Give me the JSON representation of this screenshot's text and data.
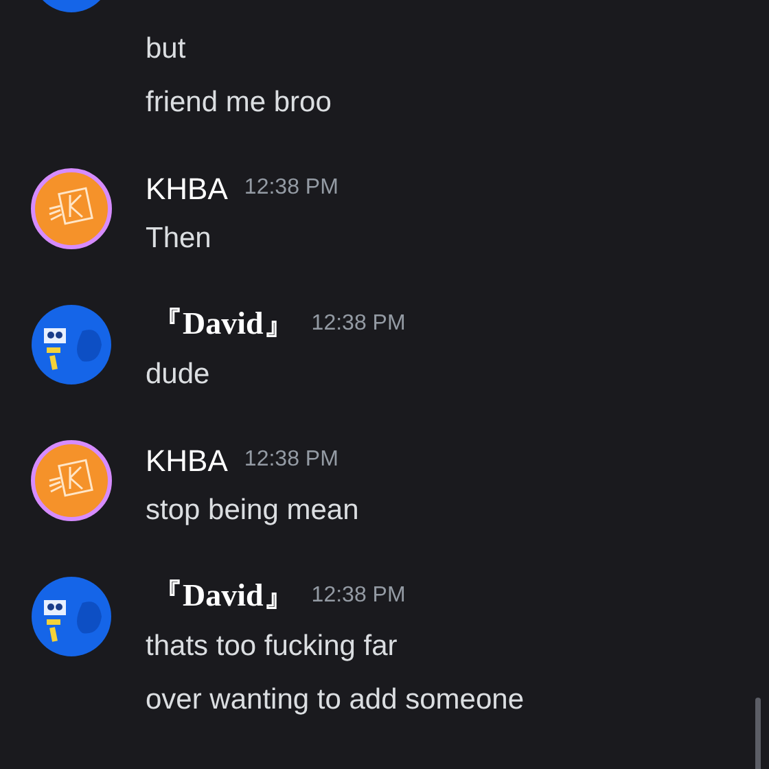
{
  "messages": [
    {
      "kind": "blue",
      "lines": [
        "but",
        "friend me broo"
      ]
    },
    {
      "kind": "orange",
      "author": "KHBA",
      "time": "12:38 PM",
      "lines": [
        "Then"
      ]
    },
    {
      "kind": "blue",
      "author": "『David』",
      "time": "12:38 PM",
      "lines": [
        "dude"
      ]
    },
    {
      "kind": "orange",
      "author": "KHBA",
      "time": "12:38 PM",
      "lines": [
        "stop being mean"
      ]
    },
    {
      "kind": "blue",
      "author": "『David』",
      "time": "12:38 PM",
      "lines": [
        "thats too fucking far",
        "over wanting to add someone"
      ]
    }
  ]
}
